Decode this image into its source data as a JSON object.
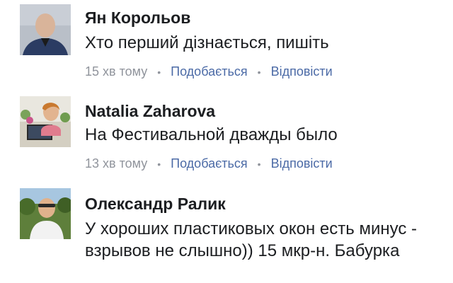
{
  "comments": [
    {
      "author": "Ян Корольов",
      "text": "Хто перший дізнається, пишіть",
      "time": "15 хв тому",
      "like_label": "Подобається",
      "reply_label": "Відповісти"
    },
    {
      "author": "Natalia  Zaharova",
      "text": "На Фестивальной дважды было",
      "time": "13 хв тому",
      "like_label": "Подобається",
      "reply_label": "Відповісти"
    },
    {
      "author": "Олександр Ралик",
      "text": "У хороших пластиковых окон есть минус - взрывов не слышно)) 15 мкр-н. Бабурка"
    }
  ],
  "separator": "•",
  "colors": {
    "text": "#1c1e21",
    "meta": "#90949c",
    "link": "#4b6aa6"
  }
}
